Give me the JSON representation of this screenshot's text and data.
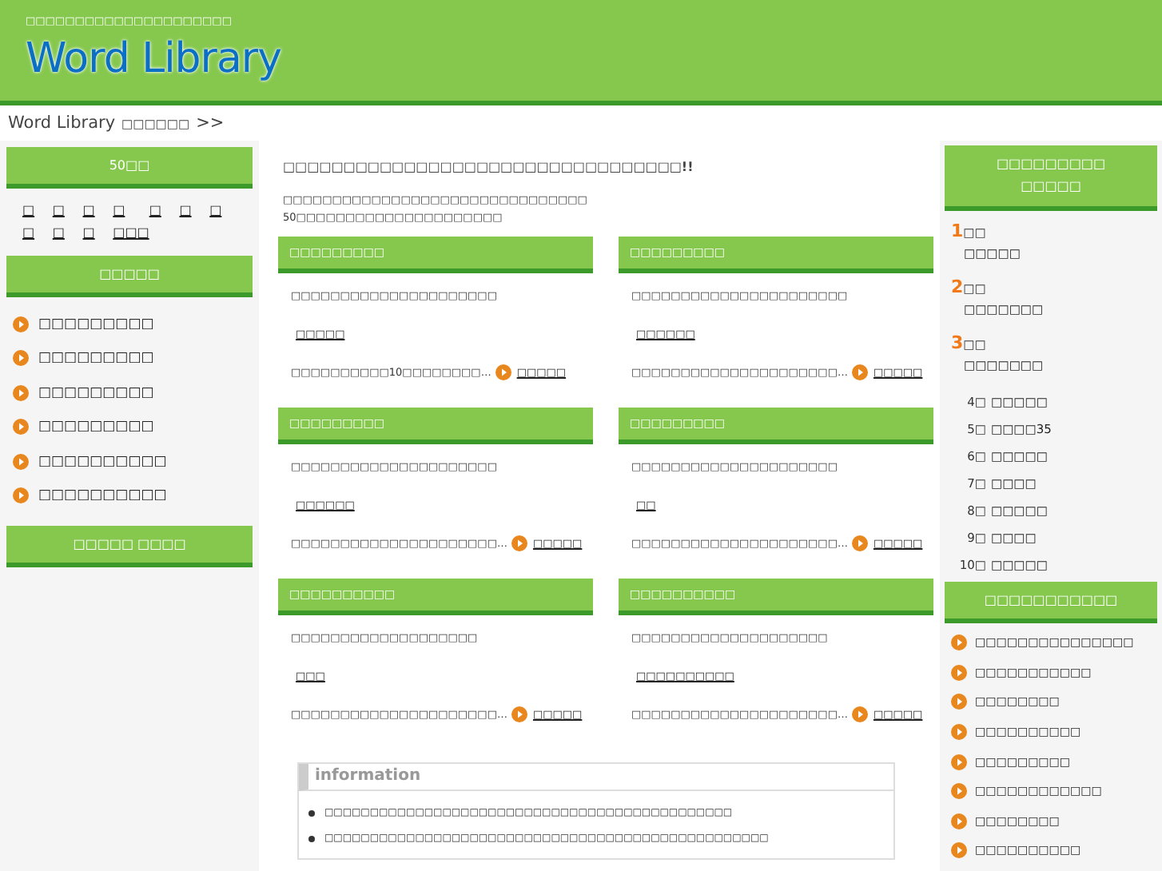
{
  "header": {
    "tagline": "□□□□□□□□□□□□□□□□□□□□□",
    "logo": "Word Library"
  },
  "breadcrumb": {
    "home": "Word Library",
    "current": "□□□□□□",
    "separator": ">>"
  },
  "left": {
    "kana_title": "50□□",
    "kana": [
      "□",
      "□",
      "□",
      "□",
      "□",
      "□",
      "□",
      "□",
      "□",
      "□",
      "□□□"
    ],
    "category_title": "□□□□□",
    "categories": [
      "□□□□□□□□□",
      "□□□□□□□□□",
      "□□□□□□□□□",
      "□□□□□□□□□",
      "□□□□□□□□□□",
      "□□□□□□□□□□"
    ],
    "bottom_button": "□□□□□ □□□□"
  },
  "main": {
    "title": "□□□□□□□□□□□□□□□□□□□□□□□□□□□□□□□□□!!",
    "intro": [
      "□□□□□□□□□□□□□□□□□□□□□□□□□□□□□□□",
      "50□□□□□□□□□□□□□□□□□□□□□"
    ],
    "cards": [
      {
        "title": "□□□□□□□□□",
        "desc": "□□□□□□□□□□□□□□□□□□□□□",
        "word": "□□□□□",
        "excerpt": "□□□□□□□□□□10□□□□□□□□…",
        "more": "□□□□□"
      },
      {
        "title": "□□□□□□□□□",
        "desc": "□□□□□□□□□□□□□□□□□□□□□□",
        "word": "□□□□□□",
        "excerpt": "□□□□□□□□□□□□□□□□□□□□□…",
        "more": "□□□□□"
      },
      {
        "title": "□□□□□□□□□",
        "desc": "□□□□□□□□□□□□□□□□□□□□□",
        "word": "□□□□□□",
        "excerpt": "□□□□□□□□□□□□□□□□□□□□□…",
        "more": "□□□□□"
      },
      {
        "title": "□□□□□□□□□",
        "desc": "□□□□□□□□□□□□□□□□□□□□□",
        "word": "□□",
        "excerpt": "□□□□□□□□□□□□□□□□□□□□□…",
        "more": "□□□□□"
      },
      {
        "title": "□□□□□□□□□□",
        "desc": "□□□□□□□□□□□□□□□□□□□",
        "word": "□□□",
        "excerpt": "□□□□□□□□□□□□□□□□□□□□□…",
        "more": "□□□□□"
      },
      {
        "title": "□□□□□□□□□□",
        "desc": "□□□□□□□□□□□□□□□□□□□□",
        "word": "□□□□□□□□□□",
        "excerpt": "□□□□□□□□□□□□□□□□□□□□□…",
        "more": "□□□□□"
      }
    ],
    "information": {
      "title": "information",
      "items": [
        "□□□□□□□□□□□□□□□□□□□□□□□□□□□□□□□□□□□□□□□□□□□□□",
        "□□□□□□□□□□□□□□□□□□□□□□□□□□□□□□□□□□□□□□□□□□□□□□□□□"
      ]
    }
  },
  "right": {
    "ranking_title": [
      "□□□□□□□□□",
      "□□□□□"
    ],
    "ranking": [
      {
        "kind": "top",
        "rank": "1",
        "label": "□□",
        "word": "□□□□□"
      },
      {
        "kind": "top",
        "rank": "2",
        "label": "□□",
        "word": "□□□□□□□"
      },
      {
        "kind": "top",
        "rank": "3",
        "label": "□□",
        "word": "□□□□□□□"
      },
      {
        "kind": "rest",
        "rank": "4□",
        "word": "□□□□□"
      },
      {
        "kind": "rest",
        "rank": "5□",
        "word": "□□□□35"
      },
      {
        "kind": "rest",
        "rank": "6□",
        "word": "□□□□□"
      },
      {
        "kind": "rest",
        "rank": "7□",
        "word": "□□□□"
      },
      {
        "kind": "rest",
        "rank": "8□",
        "word": "□□□□□"
      },
      {
        "kind": "rest",
        "rank": "9□",
        "word": "□□□□"
      },
      {
        "kind": "rest",
        "rank": "10□",
        "word": "□□□□□"
      }
    ],
    "links_title": "□□□□□□□□□□□",
    "links": [
      "□□□□□□□□□□□□□□□",
      "□□□□□□□□□□□",
      "□□□□□□□□",
      "□□□□□□□□□□",
      "□□□□□□□□□",
      "□□□□□□□□□□□□",
      "□□□□□□□□",
      "□□□□□□□□□□"
    ]
  }
}
